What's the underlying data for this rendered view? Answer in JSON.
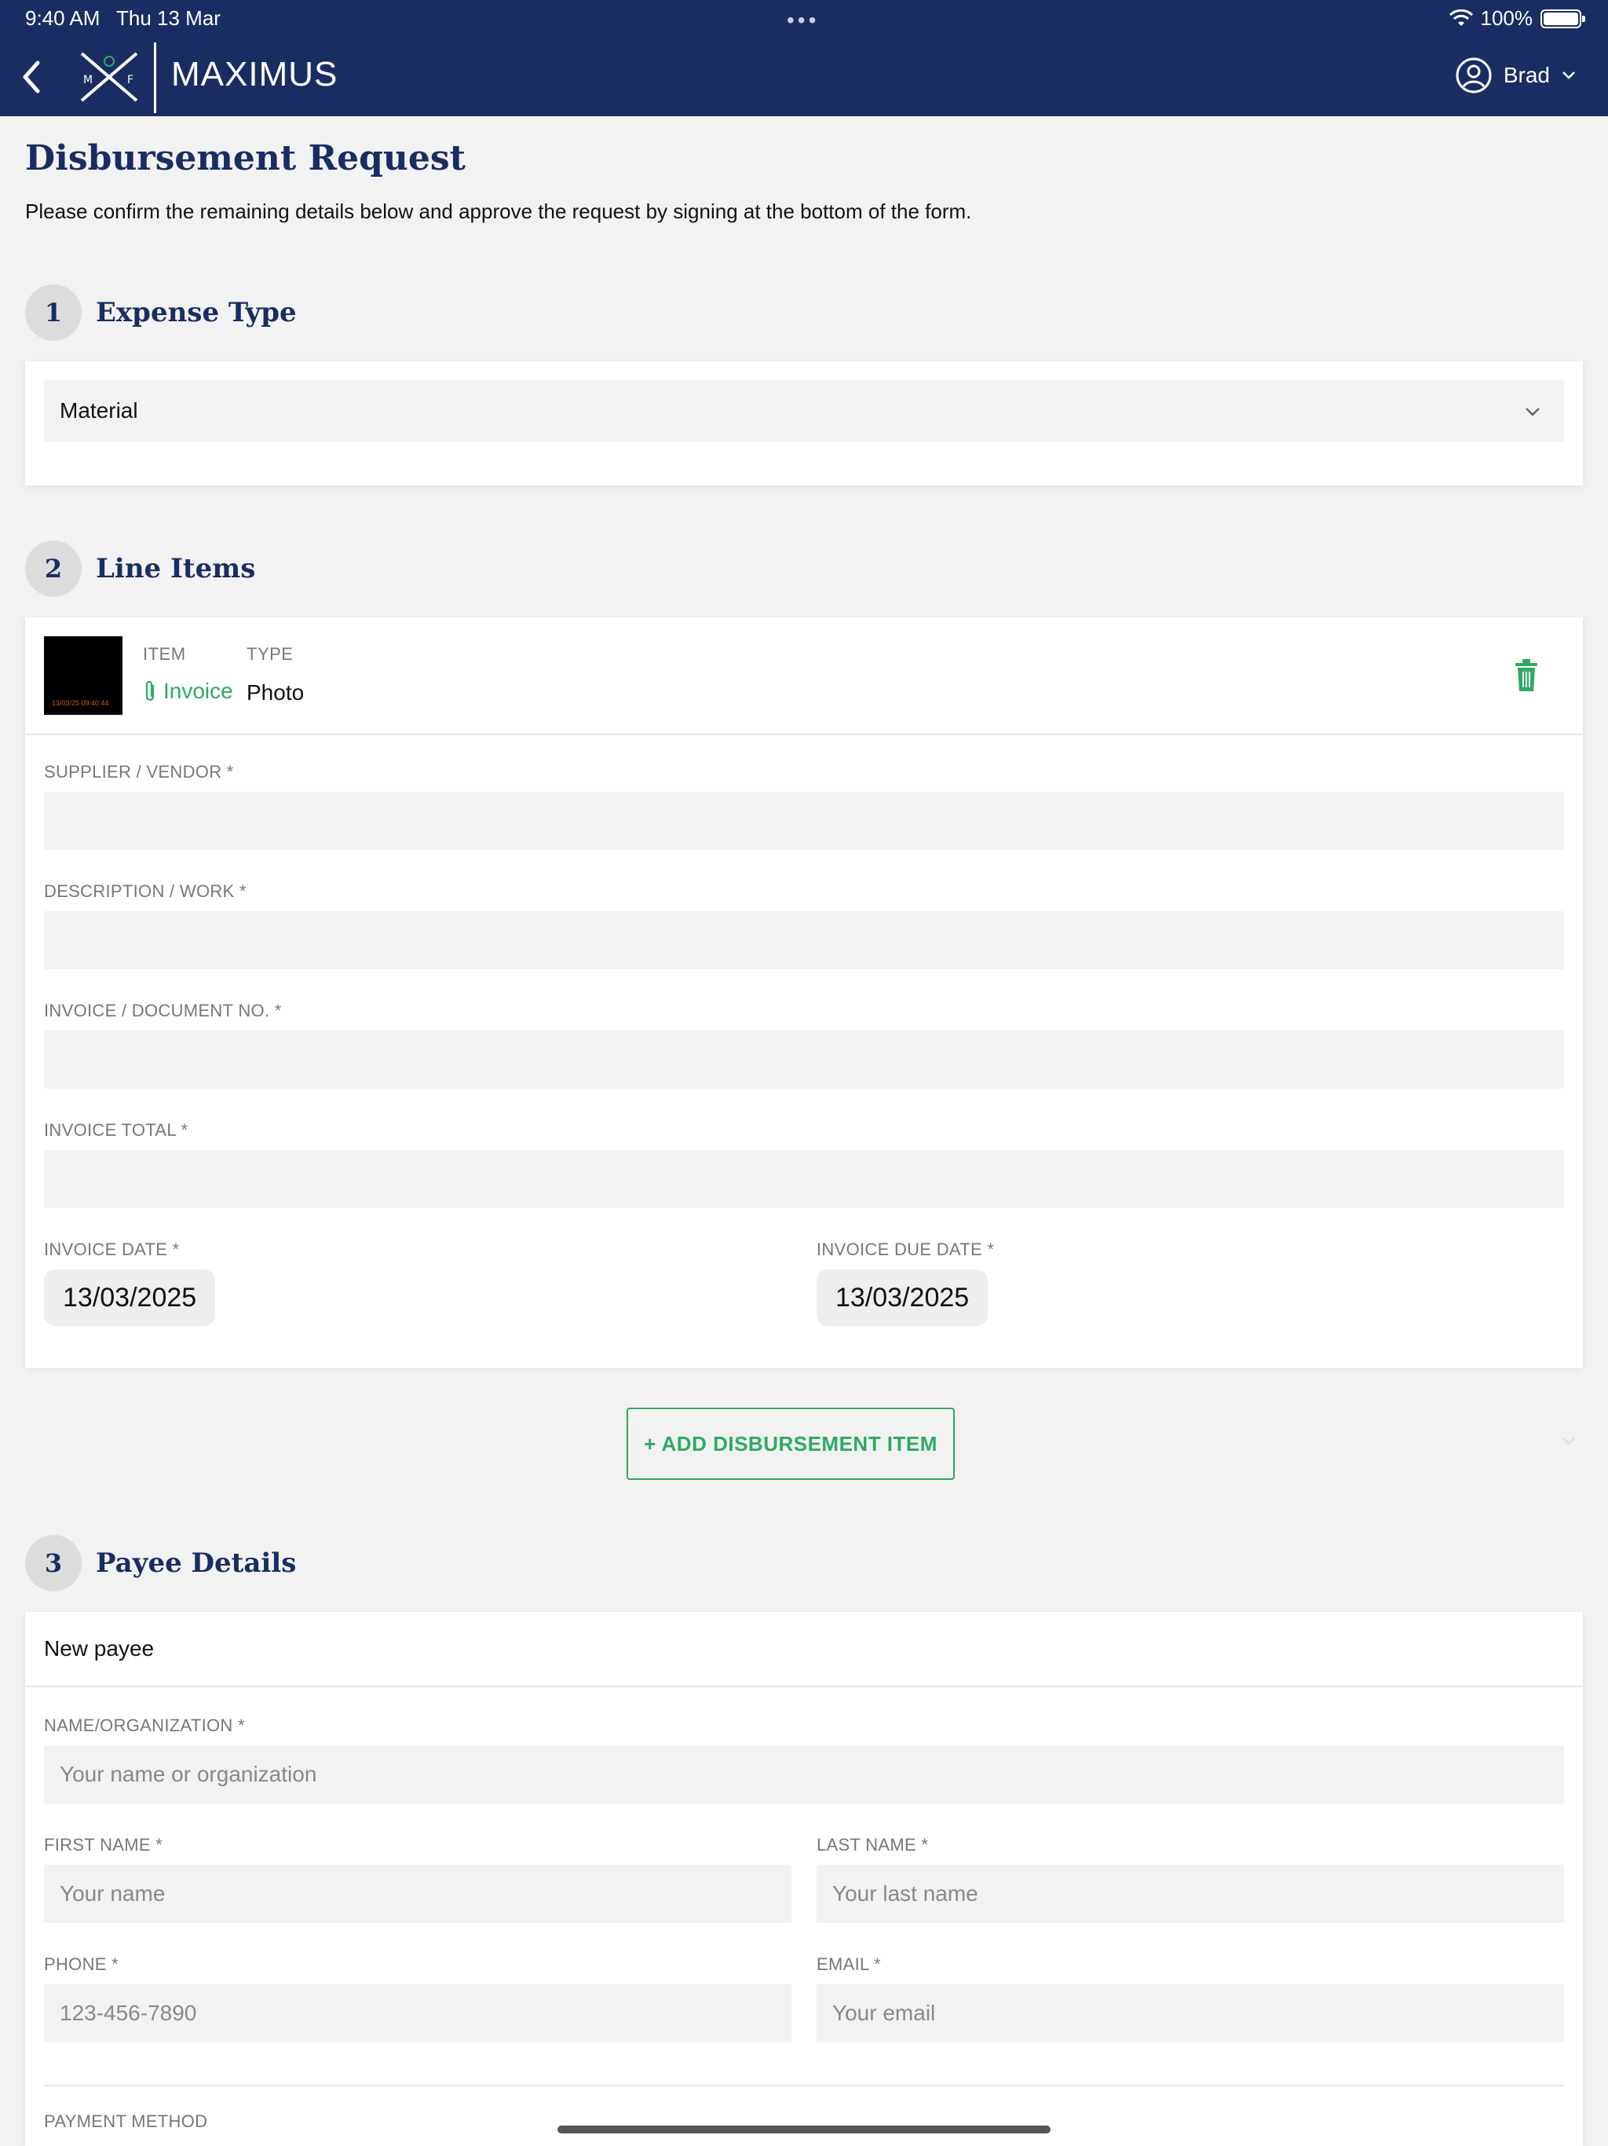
{
  "status": {
    "time": "9:40 AM",
    "date": "Thu 13 Mar",
    "battery": "100%"
  },
  "header": {
    "brand": "MAXIMUS",
    "user": "Brad"
  },
  "page": {
    "title": "Disbursement Request",
    "subtitle": "Please confirm the remaining details below and approve the request by signing at the bottom of the form."
  },
  "sections": {
    "expense": {
      "num": "1",
      "title": "Expense Type",
      "value": "Material"
    },
    "line_items": {
      "num": "2",
      "title": "Line Items",
      "item_header": "ITEM",
      "type_header": "TYPE",
      "item_value": "Invoice",
      "type_value": "Photo",
      "thumb_stamp": "13/03/25 09:40:44",
      "supplier_label": "SUPPLIER / VENDOR *",
      "supplier_value": "",
      "description_label": "DESCRIPTION / WORK *",
      "description_value": "",
      "invoice_no_label": "INVOICE / DOCUMENT NO. *",
      "invoice_no_value": "",
      "invoice_total_label": "INVOICE TOTAL *",
      "invoice_total_value": "",
      "invoice_date_label": "INVOICE DATE *",
      "invoice_date": "13/03/2025",
      "due_date_label": "INVOICE DUE DATE *",
      "due_date": "13/03/2025",
      "add_button": "+ ADD DISBURSEMENT ITEM"
    },
    "payee": {
      "num": "3",
      "title": "Payee Details",
      "selected": "New payee",
      "name_org_label": "NAME/ORGANIZATION *",
      "name_org_placeholder": "Your name or organization",
      "first_name_label": "FIRST NAME *",
      "first_name_placeholder": "Your name",
      "last_name_label": "LAST NAME *",
      "last_name_placeholder": "Your last name",
      "phone_label": "PHONE *",
      "phone_placeholder": "123-456-7890",
      "email_label": "EMAIL *",
      "email_placeholder": "Your email",
      "payment_method_label": "PAYMENT METHOD"
    }
  },
  "colors": {
    "navy": "#1a2d63",
    "green": "#2daa62",
    "bg": "#f2f2f2"
  }
}
